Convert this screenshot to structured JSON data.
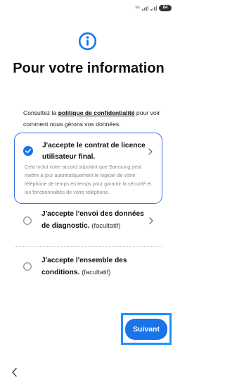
{
  "status_bar": {
    "network": "5G",
    "battery": "84"
  },
  "header": {
    "title": "Pour votre information"
  },
  "intro": {
    "prefix": "Consultez la ",
    "link": "politique de confidentialité",
    "suffix": " pour voir comment nous gérons vos données."
  },
  "options": [
    {
      "title": "J'accepte le contrat de licence utilisateur final.",
      "optional": "",
      "description": "Cela inclut votre accord stipulant que Samsung peut mettre à jour automatiquement le logiciel de votre téléphone de temps en temps pour garantir la sécurité et les fonctionnalités de votre téléphone.",
      "checked": true
    },
    {
      "title": "J'accepte l'envoi des données de diagnostic.",
      "optional": "(facultatif)",
      "checked": false
    },
    {
      "title": "J'accepte l'ensemble des conditions.",
      "optional": "(facultatif)",
      "checked": false
    }
  ],
  "footer": {
    "next_label": "Suivant"
  },
  "colors": {
    "accent": "#1a73e8",
    "highlight": "#1e90ff",
    "card_border": "#3a6ee0"
  }
}
